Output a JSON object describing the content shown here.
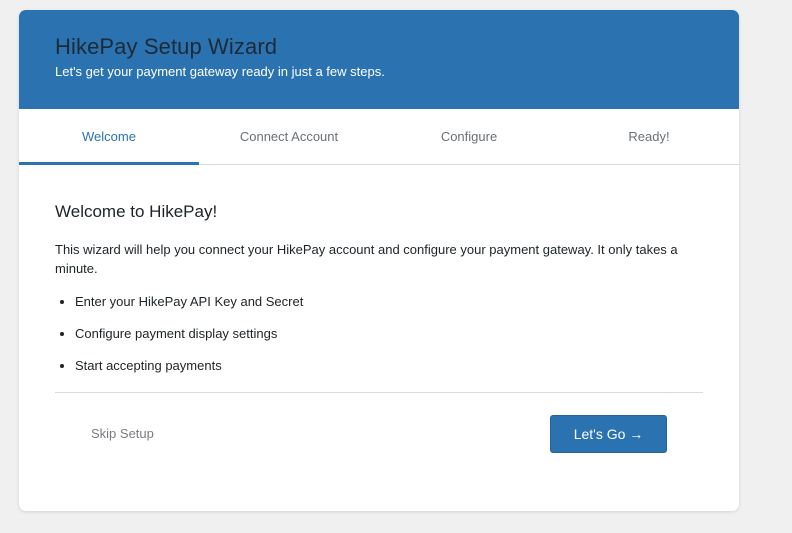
{
  "header": {
    "title": "HikePay Setup Wizard",
    "subtitle": "Let's get your payment gateway ready in just a few steps."
  },
  "steps": [
    {
      "label": "Welcome",
      "active": true
    },
    {
      "label": "Connect Account",
      "active": false
    },
    {
      "label": "Configure",
      "active": false
    },
    {
      "label": "Ready!",
      "active": false
    }
  ],
  "content": {
    "title": "Welcome to HikePay!",
    "body": "This wizard will help you connect your HikePay account and configure your payment gateway. It only takes a minute.",
    "bullets": [
      "Enter your HikePay API Key and Secret",
      "Configure payment display settings",
      "Start accepting payments"
    ]
  },
  "footer": {
    "skip_label": "Skip Setup",
    "go_label": "Let's Go →"
  },
  "colors": {
    "brand": "#2b72b1",
    "background": "#f0f0f1"
  }
}
